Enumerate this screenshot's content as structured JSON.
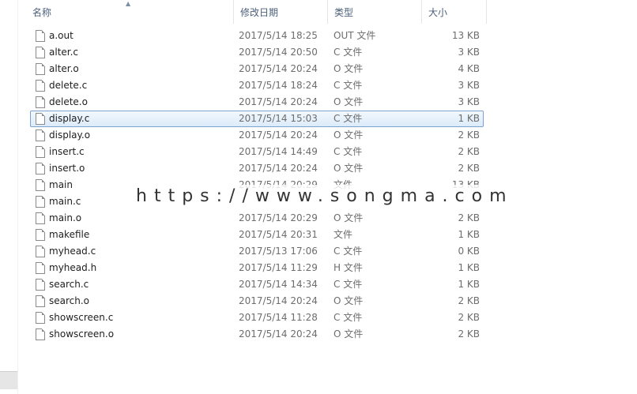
{
  "columns": {
    "name": "名称",
    "date": "修改日期",
    "type": "类型",
    "size": "大小"
  },
  "files": [
    {
      "name": "a.out",
      "date": "2017/5/14 18:25",
      "type": "OUT 文件",
      "size": "13 KB"
    },
    {
      "name": "alter.c",
      "date": "2017/5/14 20:50",
      "type": "C 文件",
      "size": "3 KB"
    },
    {
      "name": "alter.o",
      "date": "2017/5/14 20:24",
      "type": "O 文件",
      "size": "4 KB"
    },
    {
      "name": "delete.c",
      "date": "2017/5/14 18:24",
      "type": "C 文件",
      "size": "3 KB"
    },
    {
      "name": "delete.o",
      "date": "2017/5/14 20:24",
      "type": "O 文件",
      "size": "3 KB"
    },
    {
      "name": "display.c",
      "date": "2017/5/14 15:03",
      "type": "C 文件",
      "size": "1 KB",
      "selected": true
    },
    {
      "name": "display.o",
      "date": "2017/5/14 20:24",
      "type": "O 文件",
      "size": "2 KB"
    },
    {
      "name": "insert.c",
      "date": "2017/5/14 14:49",
      "type": "C 文件",
      "size": "2 KB"
    },
    {
      "name": "insert.o",
      "date": "2017/5/14 20:24",
      "type": "O 文件",
      "size": "2 KB"
    },
    {
      "name": "main",
      "date": "2017/5/14 20:29",
      "type": "文件",
      "size": "13 KB"
    },
    {
      "name": "main.c",
      "date": "",
      "type": "",
      "size": ""
    },
    {
      "name": "main.o",
      "date": "2017/5/14 20:29",
      "type": "O 文件",
      "size": "2 KB"
    },
    {
      "name": "makefile",
      "date": "2017/5/14 20:31",
      "type": "文件",
      "size": "1 KB"
    },
    {
      "name": "myhead.c",
      "date": "2017/5/13 17:06",
      "type": "C 文件",
      "size": "0 KB"
    },
    {
      "name": "myhead.h",
      "date": "2017/5/14 11:29",
      "type": "H 文件",
      "size": "1 KB"
    },
    {
      "name": "search.c",
      "date": "2017/5/14 14:34",
      "type": "C 文件",
      "size": "1 KB"
    },
    {
      "name": "search.o",
      "date": "2017/5/14 20:24",
      "type": "O 文件",
      "size": "2 KB"
    },
    {
      "name": "showscreen.c",
      "date": "2017/5/14 11:28",
      "type": "C 文件",
      "size": "2 KB"
    },
    {
      "name": "showscreen.o",
      "date": "2017/5/14 20:24",
      "type": "O 文件",
      "size": "2 KB"
    }
  ],
  "watermark": "https://www.songma.com",
  "icons": {
    "file": "file-icon",
    "sort": "sort-up-icon"
  }
}
